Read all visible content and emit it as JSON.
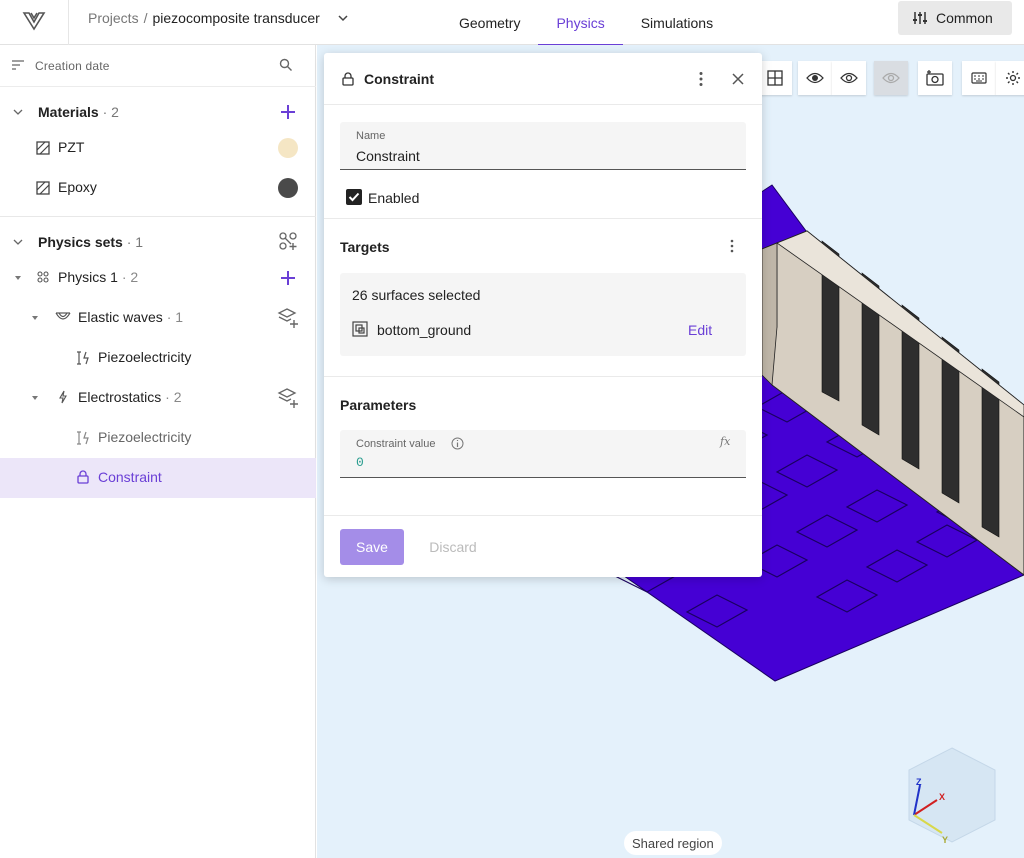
{
  "header": {
    "breadcrumb_root": "Projects",
    "breadcrumb_sep": "/",
    "project_name": "piezocomposite transducer",
    "tabs": [
      {
        "label": "Geometry"
      },
      {
        "label": "Physics"
      },
      {
        "label": "Simulations"
      }
    ],
    "common_label": "Common"
  },
  "sidebar": {
    "sort_label": "Creation date",
    "materials": {
      "title": "Materials",
      "count": "· 2",
      "items": [
        {
          "label": "PZT",
          "color": "#f5e6c4"
        },
        {
          "label": "Epoxy",
          "color": "#4a4a4a"
        }
      ]
    },
    "physics_sets": {
      "title": "Physics sets",
      "count": "· 1",
      "physics1": {
        "label": "Physics 1",
        "count": "· 2"
      },
      "elastic": {
        "label": "Elastic waves",
        "count": "· 1"
      },
      "elastic_child": {
        "label": "Piezoelectricity"
      },
      "electro": {
        "label": "Electrostatics",
        "count": "· 2"
      },
      "electro_children": [
        {
          "label": "Piezoelectricity"
        },
        {
          "label": "Constraint"
        }
      ]
    }
  },
  "panel": {
    "title": "Constraint",
    "name_label": "Name",
    "name_value": "Constraint",
    "enabled_label": "Enabled",
    "targets_title": "Targets",
    "targets_summary": "26 surfaces selected",
    "target_item": "bottom_ground",
    "edit_label": "Edit",
    "parameters_title": "Parameters",
    "constraint_label": "Constraint value",
    "constraint_value": "0",
    "fx_label": "fx",
    "save_label": "Save",
    "discard_label": "Discard"
  },
  "viewport": {
    "shared_region_label": "Shared region",
    "axes": {
      "x": "X",
      "y": "Y",
      "z": "Z"
    },
    "colors": {
      "plate": "#4500d4",
      "pzt": "#d7cfc2",
      "epoxy": "#2a2a2a",
      "background": "#e4f1fb"
    }
  }
}
